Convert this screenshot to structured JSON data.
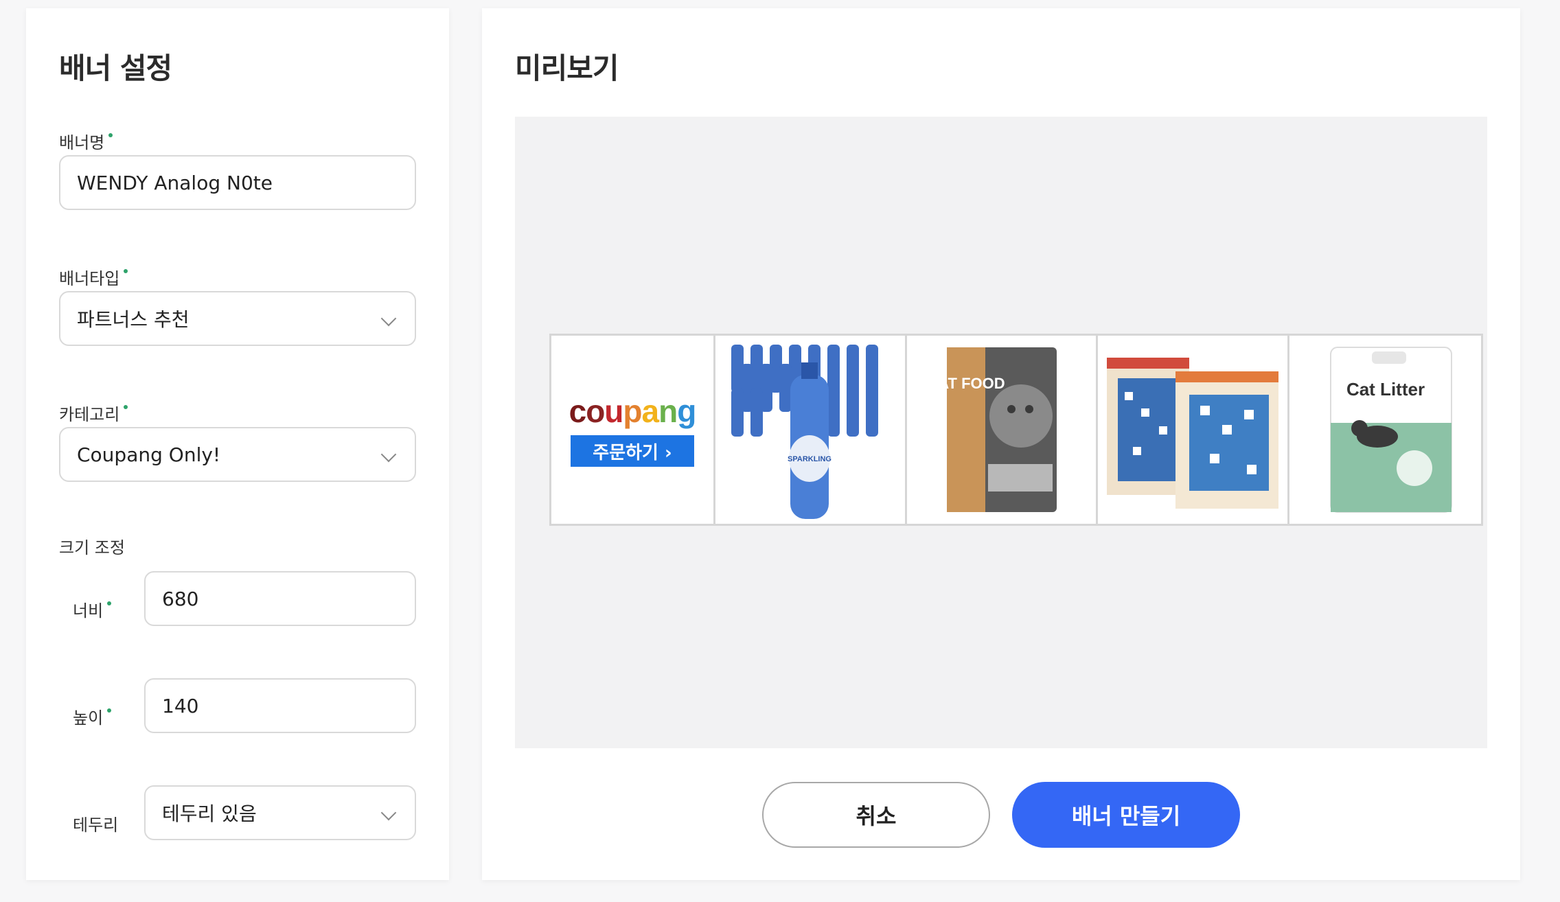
{
  "settings": {
    "title": "배너 설정",
    "name_label": "배너명",
    "name_value": "WENDY Analog N0te",
    "type_label": "배너타입",
    "type_value": "파트너스 추천",
    "category_label": "카테고리",
    "category_value": "Coupang Only!",
    "size_label": "크기 조정",
    "width_label": "너비",
    "width_value": "680",
    "height_label": "높이",
    "height_value": "140",
    "border_label": "테두리",
    "border_value": "테두리 있음"
  },
  "preview": {
    "title": "미리보기",
    "banner": {
      "logo_text": "coupang",
      "order_button": "주문하기 ›",
      "products": [
        {
          "icon": "sparkling-water-bottles",
          "label": "SPARKLING"
        },
        {
          "icon": "cat-food-bag",
          "label": "CAT FOOD"
        },
        {
          "icon": "cat-scratcher-boxes",
          "label": ""
        },
        {
          "icon": "cat-litter-bag",
          "label": "Cat Litter"
        }
      ]
    }
  },
  "actions": {
    "cancel": "취소",
    "create": "배너 만들기"
  },
  "colors": {
    "accent": "#3467f5",
    "required_dot": "#2ea36b",
    "coupang_blue": "#1d74e2"
  }
}
